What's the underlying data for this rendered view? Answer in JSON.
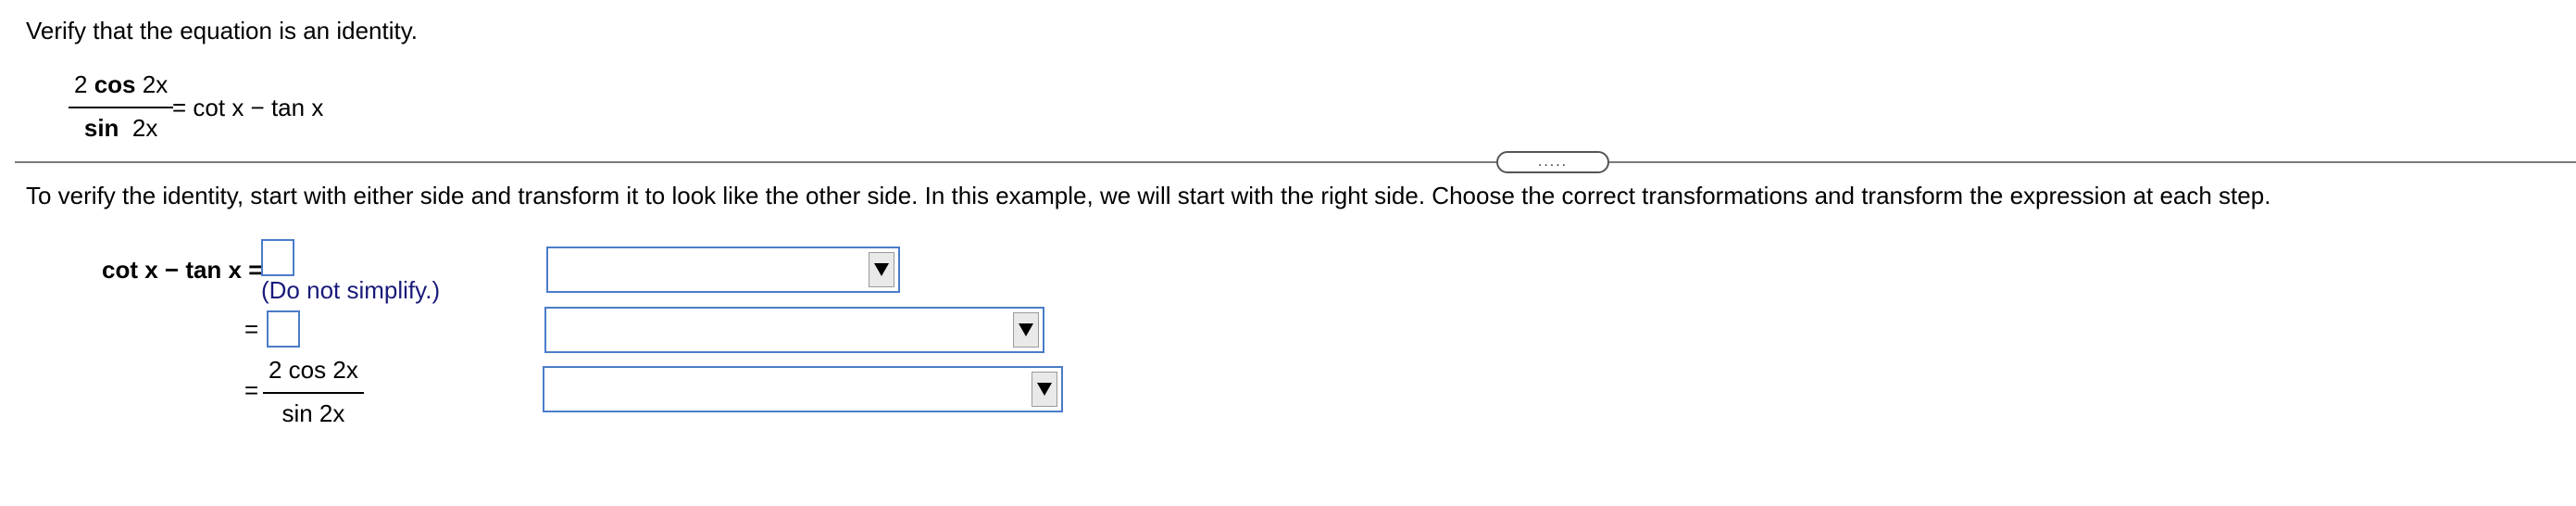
{
  "prompt": "Verify that the equation is an identity.",
  "equation": {
    "numerator_coef": "2",
    "numerator_func": "cos",
    "numerator_arg": "2x",
    "denominator_func": "sin",
    "denominator_arg": "2x",
    "rhs": "= cot x − tan x"
  },
  "expand_button_label": ".....",
  "instruction": "To verify the identity, start with either side and transform it to look like the other side. In this example, we will start with the right side. Choose the correct transformations and transform the expression at each step.",
  "steps": {
    "step1_lhs": "cot x −  tan x =",
    "step1_note": "(Do not simplify.)",
    "step2_eq": "=",
    "step3_eq": "=",
    "step3_num": "2 cos 2x",
    "step3_den": "sin  2x"
  },
  "dropdowns": [
    {
      "selected": ""
    },
    {
      "selected": ""
    },
    {
      "selected": ""
    }
  ]
}
